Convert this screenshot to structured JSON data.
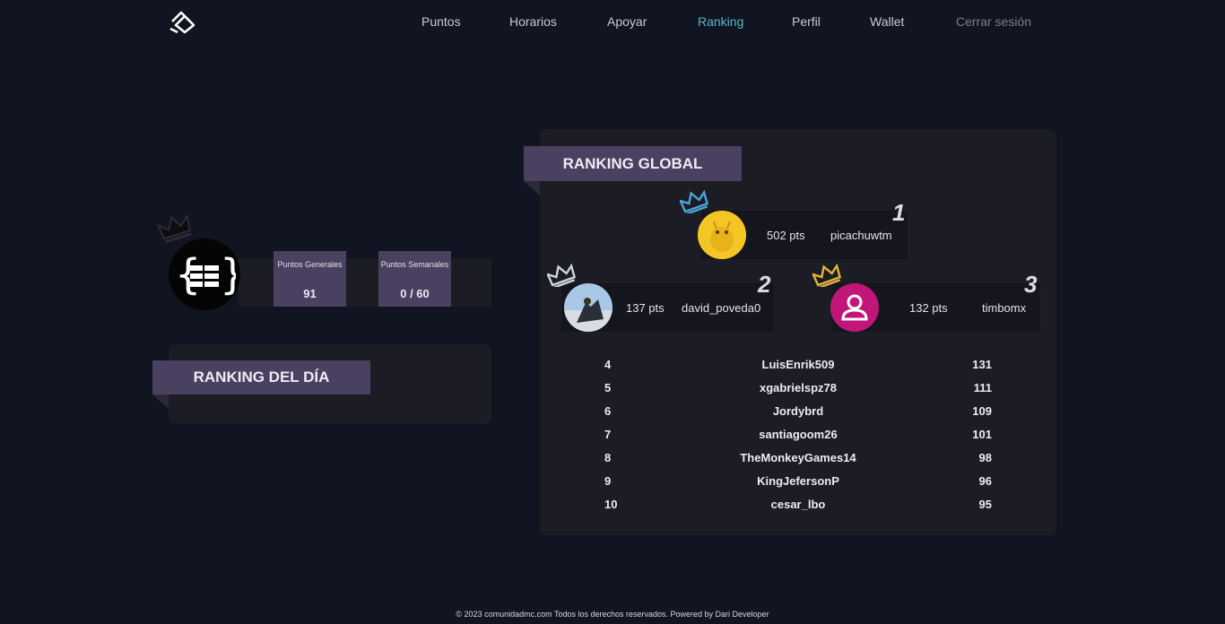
{
  "nav": {
    "items": [
      "Puntos",
      "Horarios",
      "Apoyar",
      "Ranking",
      "Perfil",
      "Wallet",
      "Cerrar sesión"
    ],
    "active": "Ranking",
    "logo_icon": "dmc-logo-icon"
  },
  "profile": {
    "avatar_icon": "code-braces-icon",
    "crown_icon": "crown-outline-icon",
    "stats": [
      {
        "label": "Puntos Generales",
        "value": "91"
      },
      {
        "label": "Puntos Semanales",
        "value": "0 / 60"
      }
    ]
  },
  "day_ranking": {
    "title": "RANKING DEL DÍA"
  },
  "global_ranking": {
    "title": "RANKING GLOBAL",
    "podium": [
      {
        "rank": "1",
        "points": "502 pts",
        "user": "picachuwtm",
        "crown_color": "#4aa6d6"
      },
      {
        "rank": "2",
        "points": "137 pts",
        "user": "david_poveda0",
        "crown_color": "#cfd3da"
      },
      {
        "rank": "3",
        "points": "132 pts",
        "user": "timbomx",
        "crown_color": "#e6b33c"
      }
    ],
    "rows": [
      {
        "rank": "4",
        "user": "LuisEnrik509",
        "points": "131"
      },
      {
        "rank": "5",
        "user": "xgabrielspz78",
        "points": "111"
      },
      {
        "rank": "6",
        "user": "Jordybrd",
        "points": "109"
      },
      {
        "rank": "7",
        "user": "santiagoom26",
        "points": "101"
      },
      {
        "rank": "8",
        "user": "TheMonkeyGames14",
        "points": "98"
      },
      {
        "rank": "9",
        "user": "KingJefersonP",
        "points": "96"
      },
      {
        "rank": "10",
        "user": "cesar_lbo",
        "points": "95"
      }
    ]
  },
  "footer": "© 2023 comunidadmc.com Todos los derechos reservados. Powered by Dari Developer",
  "colors": {
    "background": "#111521",
    "card": "#1b1c24",
    "ribbon": "#4a4060",
    "active_link": "#5db4c4"
  }
}
